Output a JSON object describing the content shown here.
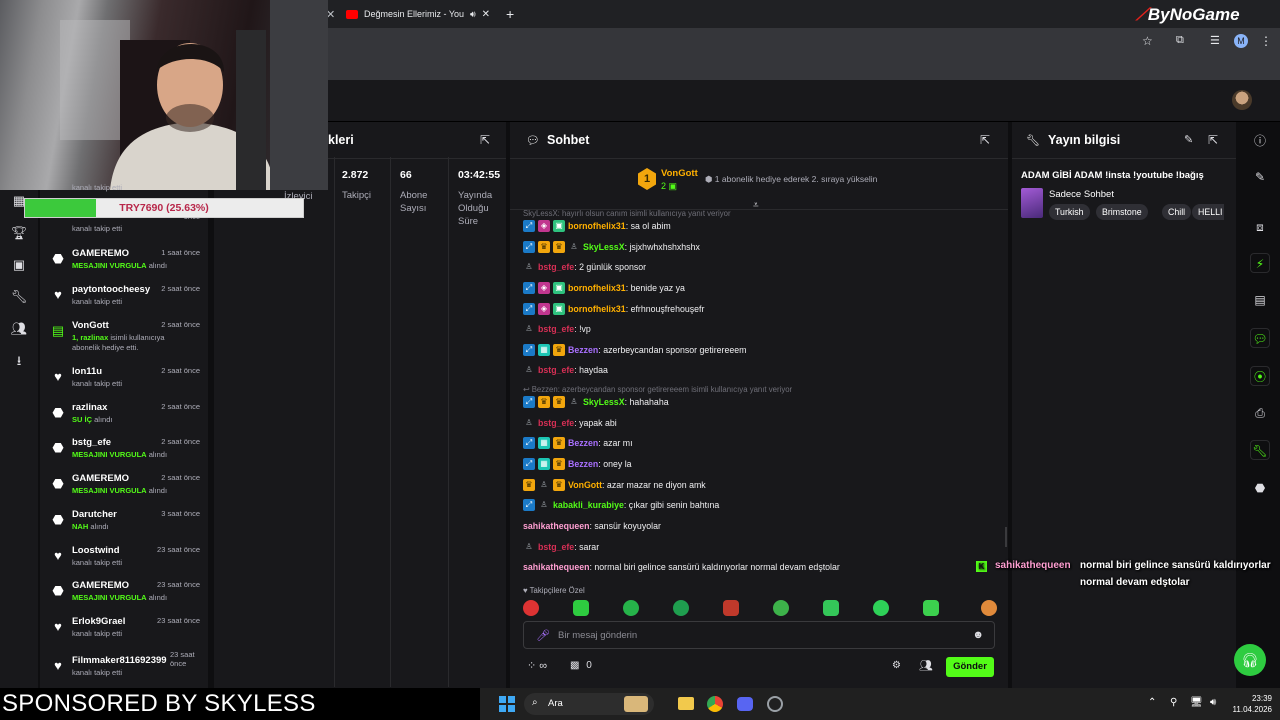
{
  "browser": {
    "tab_title": "Değmesin Ellerimiz - YouTu",
    "new_tab": "+",
    "profile_initial": "M",
    "brand": "ByNoGame"
  },
  "webcam": {
    "label": "streamer-webcam"
  },
  "donation": {
    "text": "TRY7690 (25.63%)",
    "progress": 0.2563,
    "hidden_text": "kanalı takip etti"
  },
  "activity": {
    "items": [
      {
        "icon": "gift-icon",
        "name": "",
        "time": "önce",
        "desc": "kanalı takip etti",
        "desc_hl": ""
      },
      {
        "icon": "kick-icon",
        "name": "GAMEREMO",
        "time": "1 saat önce",
        "desc": "alındı",
        "desc_hl": "MESAJINI VURGULA"
      },
      {
        "icon": "heart-icon",
        "name": "paytontoocheesy",
        "time": "2 saat önce",
        "desc": "kanalı takip etti",
        "desc_hl": ""
      },
      {
        "icon": "gift-icon",
        "name": "VonGott",
        "time": "2 saat önce",
        "desc": "isimli kullanıcıya\nabonelik hediye etti.",
        "desc_hl": "1, razlinax"
      },
      {
        "icon": "heart-icon",
        "name": "lon11u",
        "time": "2 saat önce",
        "desc": "kanalı takip etti",
        "desc_hl": ""
      },
      {
        "icon": "kick-icon",
        "name": "razlinax",
        "time": "2 saat önce",
        "desc": "alındı",
        "desc_hl": "SU İÇ"
      },
      {
        "icon": "kick-icon",
        "name": "bstg_efe",
        "time": "2 saat önce",
        "desc": "alındı",
        "desc_hl": "MESAJINI VURGULA"
      },
      {
        "icon": "kick-icon",
        "name": "GAMEREMO",
        "time": "2 saat önce",
        "desc": "alındı",
        "desc_hl": "MESAJINI VURGULA"
      },
      {
        "icon": "kick-icon",
        "name": "Darutcher",
        "time": "3 saat önce",
        "desc": "alındı",
        "desc_hl": "NAH"
      },
      {
        "icon": "heart-icon",
        "name": "Loostwind",
        "time": "23 saat önce",
        "desc": "kanalı takip etti",
        "desc_hl": ""
      },
      {
        "icon": "kick-icon",
        "name": "GAMEREMO",
        "time": "23 saat önce",
        "desc": "alındı",
        "desc_hl": "MESAJINI VURGULA"
      },
      {
        "icon": "heart-icon",
        "name": "Erlok9Grael",
        "time": "23 saat önce",
        "desc": "kanalı takip etti",
        "desc_hl": ""
      },
      {
        "icon": "heart-icon",
        "name": "Filmmaker811692399",
        "time": "23 saat önce",
        "desc": "kanalı takip etti",
        "desc_hl": ""
      }
    ]
  },
  "stats": {
    "title": "kleri",
    "viewers_label": "İzleyici",
    "followers_value": "2.872",
    "followers_label": "Takipçi",
    "subs_value": "66",
    "subs_label_1": "Abone",
    "subs_label_2": "Sayısı",
    "uptime_value": "03:42:55",
    "uptime_label_1": "Yayında",
    "uptime_label_2": "Olduğu",
    "uptime_label_3": "Süre"
  },
  "chat": {
    "title": "Sohbet",
    "pinned_user": "VonGott",
    "pinned_rank": "1",
    "pinned_count": "2",
    "pinned_text": "1 abonelik hediye ederek 2. sıraya yükselin",
    "reply_top": "SkyLessX: hayırlı olsun canım isimli kullanıcıya yanıt veriyor",
    "reply_mid": "Bezzen: azerbeycandan sponsor getirereeem isimli kullanıcıya yanıt veriyor",
    "messages": [
      {
        "user": "bornofhelix31",
        "color": "#ffb000",
        "text": ": sa ol abim",
        "badges": [
          "b-blue",
          "b-pink",
          "b-green"
        ]
      },
      {
        "user": "SkyLessX",
        "color": "#53fc18",
        "text": ": jsjxhwhxhshxhshx",
        "badges": [
          "b-blue",
          "b-gold",
          "b-gold",
          "b-gray"
        ]
      },
      {
        "user": "bstg_efe",
        "color": "#d62f55",
        "text": ": 2 günlük sponsor",
        "badges": [
          "b-gray"
        ]
      },
      {
        "user": "bornofhelix31",
        "color": "#ffb000",
        "text": ": benide yaz ya",
        "badges": [
          "b-blue",
          "b-pink",
          "b-green"
        ]
      },
      {
        "user": "bornofhelix31",
        "color": "#ffb000",
        "text": ": efrhnouşfrehouşefr",
        "badges": [
          "b-blue",
          "b-pink",
          "b-green"
        ]
      },
      {
        "user": "bstg_efe",
        "color": "#d62f55",
        "text": ": !vp",
        "badges": [
          "b-gray"
        ]
      },
      {
        "user": "Bezzen",
        "color": "#a970ff",
        "text": ": azerbeycandan sponsor getirereeem",
        "badges": [
          "b-blue",
          "b-teal",
          "b-gold"
        ]
      },
      {
        "user": "bstg_efe",
        "color": "#d62f55",
        "text": ": haydaa",
        "badges": [
          "b-gray"
        ]
      },
      {
        "user": "SkyLessX",
        "color": "#53fc18",
        "text": ": hahahaha",
        "badges": [
          "b-blue",
          "b-gold",
          "b-gold",
          "b-gray"
        ]
      },
      {
        "user": "bstg_efe",
        "color": "#d62f55",
        "text": ": yapak abi",
        "badges": [
          "b-gray"
        ]
      },
      {
        "user": "Bezzen",
        "color": "#a970ff",
        "text": ": azar mı",
        "badges": [
          "b-blue",
          "b-teal",
          "b-gold"
        ]
      },
      {
        "user": "Bezzen",
        "color": "#a970ff",
        "text": ": oney la",
        "badges": [
          "b-blue",
          "b-teal",
          "b-gold"
        ]
      },
      {
        "user": "VonGott",
        "color": "#ffb000",
        "text": ": azar mazar ne diyon amk",
        "badges": [
          "b-gold",
          "b-gray",
          "b-gold"
        ]
      },
      {
        "user": "kabakli_kurabiye",
        "color": "#53fc18",
        "text": ": çıkar gibi senin bahtına",
        "badges": [
          "b-blue",
          "b-gray"
        ]
      },
      {
        "user": "sahikathequeen",
        "color": "#ff9fd2",
        "text": ": sansür koyuyolar",
        "badges": []
      },
      {
        "user": "bstg_efe",
        "color": "#d62f55",
        "text": ": sarar",
        "badges": [
          "b-gray"
        ]
      },
      {
        "user": "sahikathequeen",
        "color": "#ff9fd2",
        "text": ": normal biri gelince sansürü kaldırıyorlar normal devam edştolar",
        "badges": []
      }
    ],
    "emote_section": "Takipçilere Özel",
    "input_placeholder": "Bir mesaj gönderin",
    "points": "∞",
    "chest_count": "0",
    "send_label": "Gönder"
  },
  "info": {
    "title": "Yayın bilgisi",
    "stream_title": "ADAM GİBİ ADAM !insta !youtube !bağış",
    "category": "Sadece Sohbet",
    "tags": [
      "Turkish",
      "Brimstone",
      "Chill",
      "HELLI"
    ]
  },
  "overlay": {
    "user": "sahikathequeen",
    "line1": "normal biri gelince sansürü kaldırıyorlar",
    "line2": "normal devam edştolar"
  },
  "sponsor": "SPONSORED BY SKYLESS",
  "taskbar": {
    "search": "Ara",
    "time": "23:39",
    "date": "11.04.2026"
  },
  "colors": {
    "accent": "#53fc18",
    "panel": "#18181b",
    "bg": "#0e0e10"
  }
}
